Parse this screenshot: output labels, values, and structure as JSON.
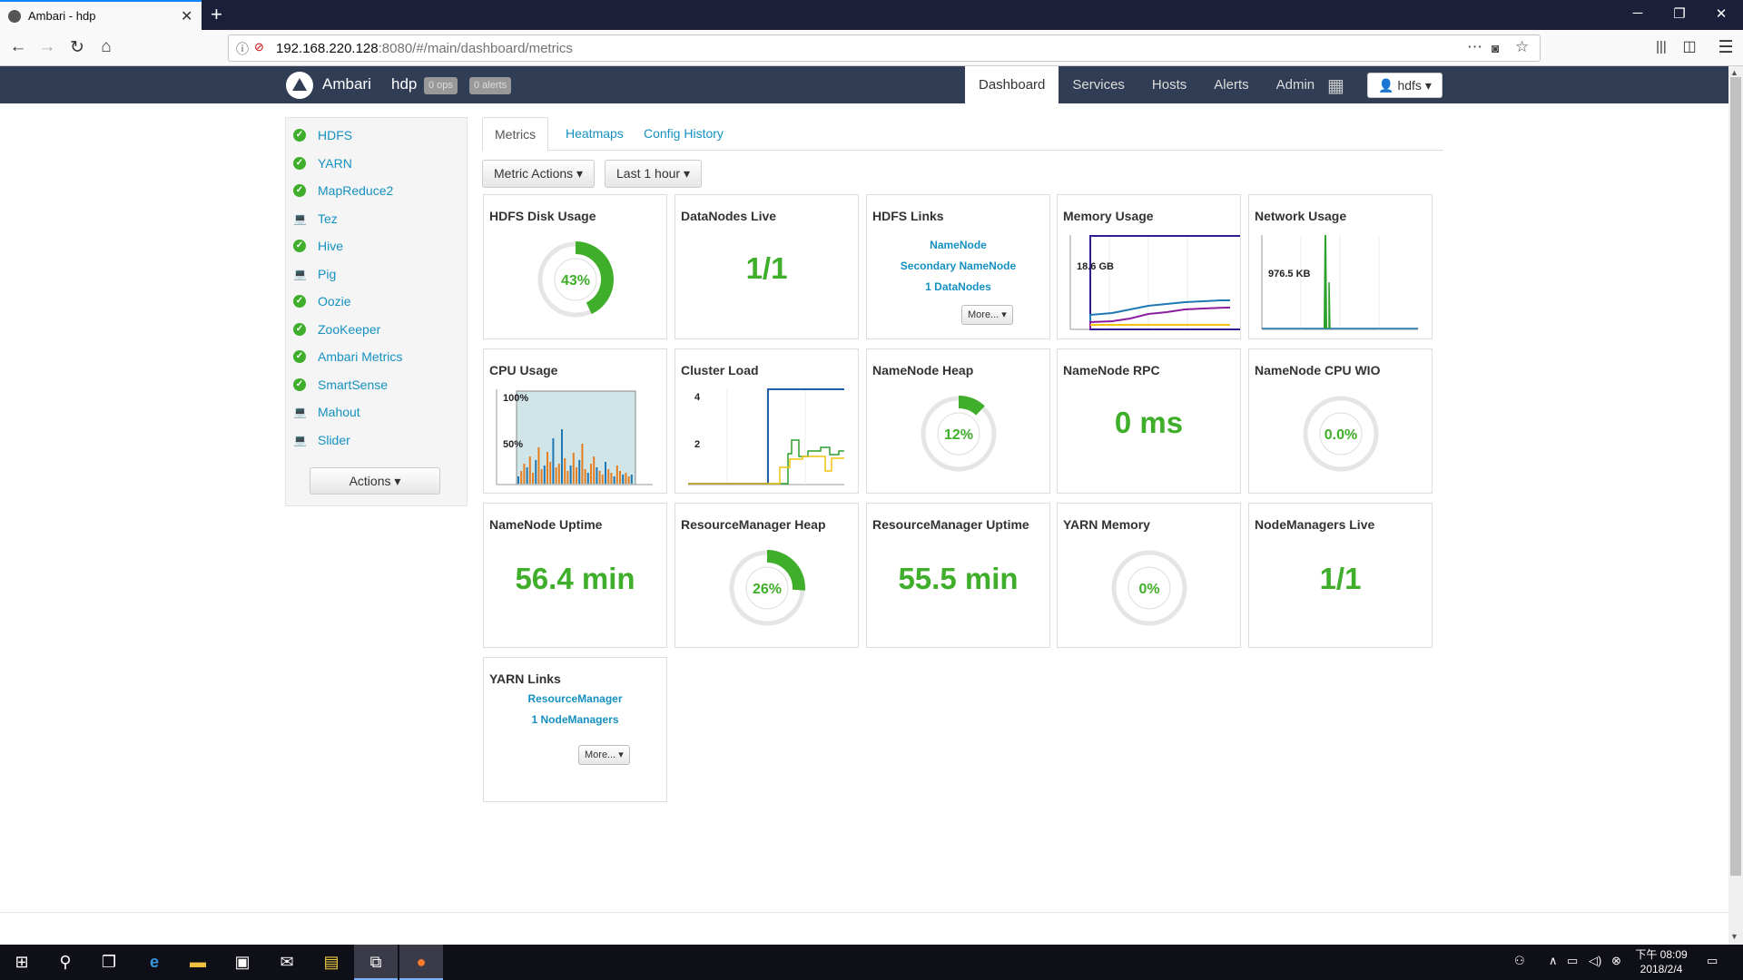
{
  "browser": {
    "tab_title": "Ambari - hdp",
    "url_host": "192.168.220.128",
    "url_rest": ":8080/#/main/dashboard/metrics"
  },
  "header": {
    "brand": "Ambari",
    "cluster": "hdp",
    "ops_badge": "0 ops",
    "alerts_badge": "0 alerts",
    "nav": [
      "Dashboard",
      "Services",
      "Hosts",
      "Alerts",
      "Admin"
    ],
    "active_nav": "Dashboard",
    "user": "hdfs"
  },
  "sidebar": {
    "services": [
      {
        "name": "HDFS",
        "status": "started"
      },
      {
        "name": "YARN",
        "status": "started"
      },
      {
        "name": "MapReduce2",
        "status": "started"
      },
      {
        "name": "Tez",
        "status": "client"
      },
      {
        "name": "Hive",
        "status": "started"
      },
      {
        "name": "Pig",
        "status": "client"
      },
      {
        "name": "Oozie",
        "status": "started"
      },
      {
        "name": "ZooKeeper",
        "status": "started"
      },
      {
        "name": "Ambari Metrics",
        "status": "started"
      },
      {
        "name": "SmartSense",
        "status": "started"
      },
      {
        "name": "Mahout",
        "status": "client"
      },
      {
        "name": "Slider",
        "status": "client"
      }
    ],
    "actions_label": "Actions"
  },
  "tabs": [
    "Metrics",
    "Heatmaps",
    "Config History"
  ],
  "toolbar": {
    "metric_actions": "Metric Actions",
    "time_range": "Last 1 hour"
  },
  "widgets": {
    "hdfs_disk_usage": {
      "title": "HDFS Disk Usage",
      "percent": 43,
      "label": "43%"
    },
    "datanodes_live": {
      "title": "DataNodes Live",
      "value": "1/1"
    },
    "hdfs_links": {
      "title": "HDFS Links",
      "links": [
        "NameNode",
        "Secondary NameNode",
        "1 DataNodes"
      ],
      "more": "More..."
    },
    "memory_usage": {
      "title": "Memory Usage",
      "label": "18.6 GB"
    },
    "network_usage": {
      "title": "Network Usage",
      "label": "976.5 KB"
    },
    "cpu_usage": {
      "title": "CPU Usage",
      "label_top": "100%",
      "label_mid": "50%"
    },
    "cluster_load": {
      "title": "Cluster Load",
      "label_top": "4",
      "label_mid": "2"
    },
    "namenode_heap": {
      "title": "NameNode Heap",
      "percent": 12,
      "label": "12%"
    },
    "namenode_rpc": {
      "title": "NameNode RPC",
      "value": "0 ms"
    },
    "namenode_cpu_wio": {
      "title": "NameNode CPU WIO",
      "percent": 0,
      "label": "0.0%"
    },
    "namenode_uptime": {
      "title": "NameNode Uptime",
      "value": "56.4 min"
    },
    "rm_heap": {
      "title": "ResourceManager Heap",
      "percent": 26,
      "label": "26%"
    },
    "rm_uptime": {
      "title": "ResourceManager Uptime",
      "value": "55.5 min"
    },
    "yarn_memory": {
      "title": "YARN Memory",
      "percent": 0,
      "label": "0%"
    },
    "nodemanagers_live": {
      "title": "NodeManagers Live",
      "value": "1/1"
    },
    "yarn_links": {
      "title": "YARN Links",
      "links": [
        "ResourceManager",
        "1 NodeManagers"
      ],
      "more": "More..."
    }
  },
  "colors": {
    "green": "#3fae2a",
    "link": "#1491c1",
    "topbar": "#313d54"
  },
  "taskbar": {
    "time": "下午 08:09",
    "date": "2018/2/4"
  }
}
